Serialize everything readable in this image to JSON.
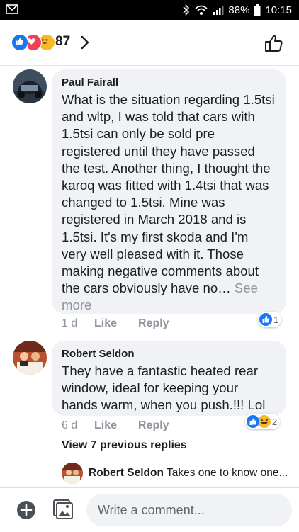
{
  "status_bar": {
    "battery": "88%",
    "time": "10:15"
  },
  "reactions_header": {
    "icons": [
      "like-reaction-icon",
      "love-reaction-icon",
      "haha-reaction-icon"
    ],
    "count": "87"
  },
  "comments": [
    {
      "author": "Paul Fairall",
      "text": "What is the situation regarding 1.5tsi and wltp, I was told that cars with 1.5tsi can only be sold pre registered until they have passed the test. Another thing, I thought the karoq was fitted with 1.4tsi that was changed to 1.5tsi. Mine was registered in March 2018 and is 1.5tsi. It's my first skoda and I'm very well pleased with it. Those making negative comments about the cars obviously have no…",
      "see_more": " See more",
      "time": "1 d",
      "like_label": "Like",
      "reply_label": "Reply",
      "reaction_count": "1"
    },
    {
      "author": "Robert Seldon",
      "text": "They have a fantastic heated rear window, ideal for keeping your hands warm, when you push.!!!  Lol",
      "time": "6 d",
      "like_label": "Like",
      "reply_label": "Reply",
      "reaction_count": "2"
    }
  ],
  "view_previous": "View 7 previous replies",
  "reply_preview": {
    "author": "Robert Seldon",
    "text": "Takes one to know one..."
  },
  "composer": {
    "placeholder": "Write a comment..."
  },
  "colors": {
    "like_blue": "#1877f2",
    "love_red": "#f33e58",
    "haha_yellow": "#f7b928",
    "bubble_gray": "#f0f2f5",
    "muted_text": "#90949c"
  }
}
